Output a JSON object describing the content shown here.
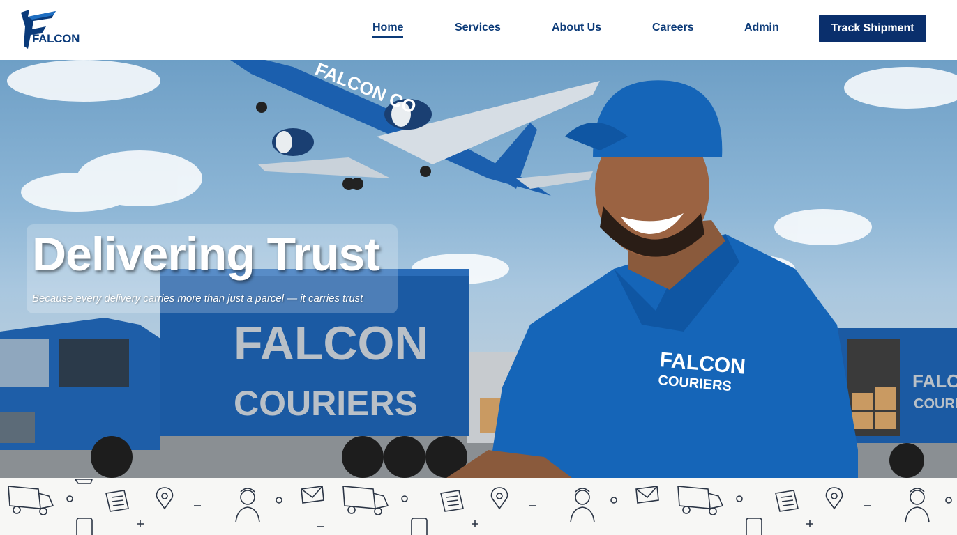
{
  "brand": {
    "logo_text": "FALCON"
  },
  "nav": {
    "items": [
      {
        "label": "Home",
        "active": true
      },
      {
        "label": "Services",
        "active": false
      },
      {
        "label": "About Us",
        "active": false
      },
      {
        "label": "Careers",
        "active": false
      },
      {
        "label": "Admin",
        "active": false
      }
    ],
    "cta_label": "Track Shipment"
  },
  "hero": {
    "title": "Delivering Trust",
    "subtitle": "Because every delivery carries more than just a parcel — it carries trust",
    "truck_text_line1": "FALCON",
    "truck_text_line2": "COURIERS",
    "shirt_text_line1": "FALCON",
    "shirt_text_line2": "COURIERS",
    "plane_text": "FALCON CO",
    "right_truck_line1": "FALCON",
    "right_truck_line2": "COURIERS"
  },
  "colors": {
    "brand_navy": "#0a2f6c",
    "nav_text": "#0b3a78",
    "uniform_blue": "#1565b8"
  },
  "pattern_icons": [
    "truck-icon",
    "document-icon",
    "location-pin-icon",
    "courier-person-icon",
    "envelope-icon",
    "phone-icon",
    "cart-icon"
  ]
}
